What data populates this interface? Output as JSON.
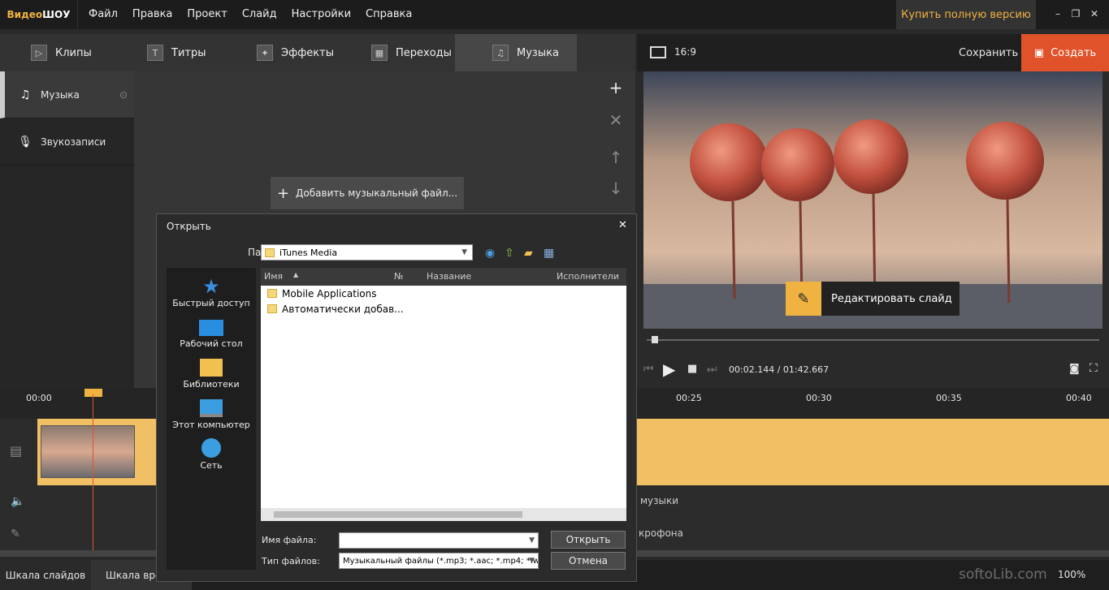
{
  "app": {
    "logo_a": "Видео",
    "logo_b": "ШОУ",
    "buy_label": "Купить полную версию"
  },
  "menu": [
    "Файл",
    "Правка",
    "Проект",
    "Слайд",
    "Настройки",
    "Справка"
  ],
  "tabs": [
    {
      "label": "Клипы"
    },
    {
      "label": "Титры"
    },
    {
      "label": "Эффекты"
    },
    {
      "label": "Переходы"
    },
    {
      "label": "Музыка"
    }
  ],
  "sidebar": {
    "items": [
      {
        "label": "Музыка"
      },
      {
        "label": "Звукозаписи"
      }
    ]
  },
  "content": {
    "add_music_label": "Добавить музыкальный файл..."
  },
  "preview": {
    "aspect": "16:9",
    "save_label": "Сохранить",
    "create_label": "Создать",
    "edit_slide_label": "Редактировать слайд",
    "time": "00:02.144 / 01:42.667"
  },
  "timeline": {
    "ticks": [
      "00:00",
      "00:25",
      "00:30",
      "00:35",
      "00:40"
    ],
    "music_label": "музыки",
    "mic_label": "крофона"
  },
  "bottom": {
    "slides_tab": "Шкала слайдов",
    "time_tab": "Шкала вре",
    "zoom": "100%",
    "watermark": "softoLib.com"
  },
  "dialog": {
    "title": "Открыть",
    "folder_label": "Папка:",
    "folder_value": "iTunes Media",
    "places": [
      "Быстрый доступ",
      "Рабочий стол",
      "Библиотеки",
      "Этот компьютер",
      "Сеть"
    ],
    "columns": [
      "Имя",
      "№",
      "Название",
      "Исполнители"
    ],
    "files": [
      "Mobile Applications",
      "Автоматически добав..."
    ],
    "filename_label": "Имя файла:",
    "filetype_label": "Тип файлов:",
    "filetype_value": "Музыкальный файлы (*.mp3; *.aac; *.mp4; *.w",
    "open_label": "Открыть",
    "cancel_label": "Отмена"
  }
}
